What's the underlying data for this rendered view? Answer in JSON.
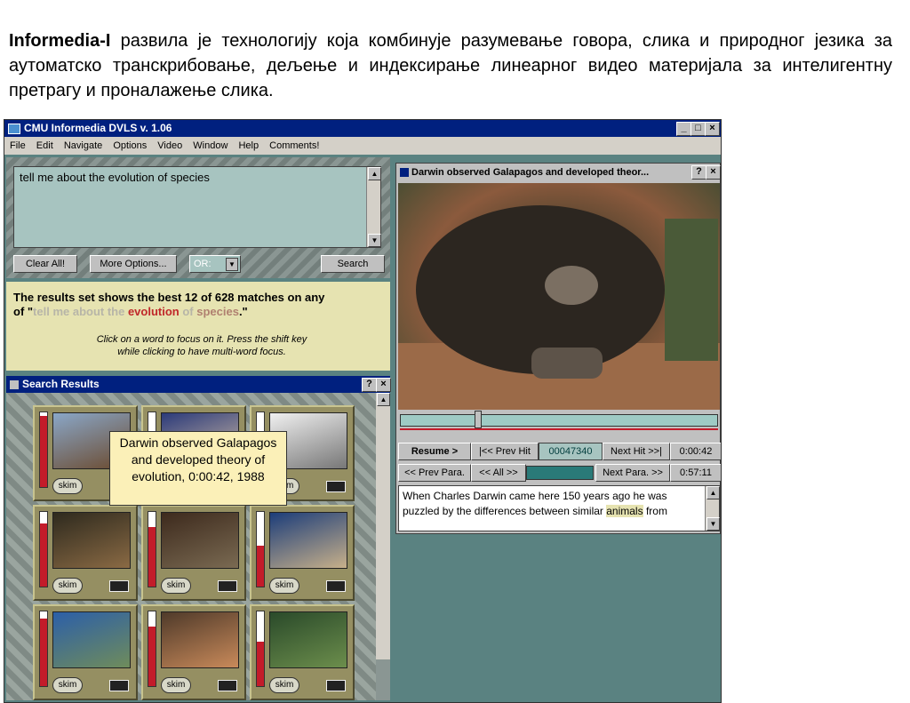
{
  "intro": {
    "lead": "Informedia-I",
    "text": "развила је технологију која комбинује разумевање говора, слика и природног језика за аутоматско транскрибовање, дељење и индексирање линеарног видео материјала за интелигентну претрагу и проналажење слика."
  },
  "window": {
    "title": "CMU Informedia DVLS v. 1.06",
    "menu": [
      "File",
      "Edit",
      "Navigate",
      "Options",
      "Video",
      "Window",
      "Help",
      "Comments!"
    ]
  },
  "query": {
    "text": "tell me about the evolution of species",
    "clear_label": "Clear All!",
    "more_label": "More Options...",
    "or_label": "OR:",
    "search_label": "Search"
  },
  "info": {
    "line1": "The results set shows the best 12 of 628 matches on any",
    "line2_prefix": "of \"",
    "q_words": [
      "tell me about the ",
      "evolution",
      " of ",
      "species"
    ],
    "line2_suffix": ".\"",
    "hint1": "Click on a word to focus on it.  Press the shift key",
    "hint2": "while clicking to have multi-word focus."
  },
  "results": {
    "title": "Search Results",
    "help": "?",
    "close": "×",
    "skim_label": "skim",
    "items": [
      {
        "relevance": 0.95,
        "colors": [
          "#8aa7c8",
          "#6b4a2e"
        ]
      },
      {
        "relevance": 0.35,
        "colors": [
          "#2b3a7a",
          "#d9c3a8"
        ]
      },
      {
        "relevance": 0.3,
        "colors": [
          "#f0f0f0",
          "#777777"
        ]
      },
      {
        "relevance": 0.85,
        "colors": [
          "#2e2a1e",
          "#8a6a44"
        ]
      },
      {
        "relevance": 0.8,
        "colors": [
          "#3d2a1d",
          "#7a6a52"
        ]
      },
      {
        "relevance": 0.55,
        "colors": [
          "#1c3d7a",
          "#c7b08a"
        ]
      },
      {
        "relevance": 0.9,
        "colors": [
          "#2c5fa8",
          "#6f8c5b"
        ]
      },
      {
        "relevance": 0.8,
        "colors": [
          "#4f3a2a",
          "#c98a5a"
        ]
      },
      {
        "relevance": 0.6,
        "colors": [
          "#2a4a2a",
          "#6c8e4c"
        ]
      }
    ],
    "tooltip": "Darwin observed Galapagos and developed theory of evolution, 0:00:42, 1988"
  },
  "video": {
    "title": "Darwin observed Galapagos and developed theor...",
    "position": 0.24,
    "resume_label": "Resume  >",
    "prev_hit_label": "|<< Prev Hit",
    "frame_value": "00047340",
    "next_hit_label": "Next Hit >>|",
    "time_value": "0:00:42",
    "prev_para_label": "<< Prev Para.",
    "all_label": "<< All >>",
    "next_para_label": "Next Para. >>",
    "duration_value": "0:57:11",
    "transcript_pre": "When Charles Darwin came here 150 years ago he was puzzled by the differences between similar ",
    "transcript_hl": "animals",
    "transcript_post": " from"
  }
}
